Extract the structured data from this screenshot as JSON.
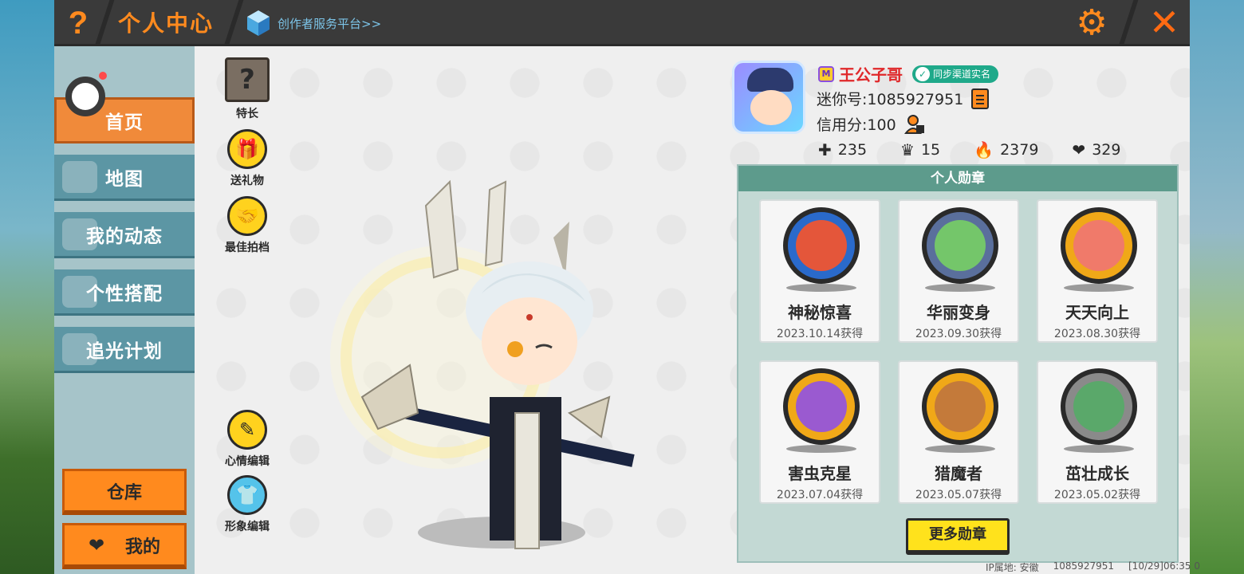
{
  "header": {
    "title": "个人中心",
    "creator_link": "创作者服务平台>>"
  },
  "nav": {
    "items": [
      {
        "label": "首页",
        "active": true
      },
      {
        "label": "地图",
        "active": false
      },
      {
        "label": "我的动态",
        "active": false
      },
      {
        "label": "个性搭配",
        "active": false
      },
      {
        "label": "追光计划",
        "active": false
      }
    ],
    "warehouse": "仓库",
    "mine": "我的"
  },
  "tools": {
    "skill": "特长",
    "gift": "送礼物",
    "partner": "最佳拍档",
    "mood": "心情编辑",
    "image": "形象编辑"
  },
  "profile": {
    "name": "王公子哥",
    "realname_badge": "同步渠道实名",
    "mini_id": "迷你号:1085927951",
    "credit": "信用分:100",
    "stats": [
      {
        "icon": "plus-icon",
        "value": "235"
      },
      {
        "icon": "fans-icon",
        "value": "15"
      },
      {
        "icon": "fire-icon",
        "value": "2379"
      },
      {
        "icon": "heart-icon",
        "value": "329"
      }
    ]
  },
  "medals": {
    "title": "个人勋章",
    "items": [
      {
        "name": "神秘惊喜",
        "date": "2023.10.14获得",
        "ring": "#2a6acb",
        "fill": "#e4563a"
      },
      {
        "name": "华丽变身",
        "date": "2023.09.30获得",
        "ring": "#5a6f9c",
        "fill": "#74c66a"
      },
      {
        "name": "天天向上",
        "date": "2023.08.30获得",
        "ring": "#f0a818",
        "fill": "#f07a6a"
      },
      {
        "name": "害虫克星",
        "date": "2023.07.04获得",
        "ring": "#f0a818",
        "fill": "#9a5ad0"
      },
      {
        "name": "猎魔者",
        "date": "2023.05.07获得",
        "ring": "#f0a818",
        "fill": "#c47a3a"
      },
      {
        "name": "茁壮成长",
        "date": "2023.05.02获得",
        "ring": "#8a8a8a",
        "fill": "#5aa86a"
      }
    ],
    "more": "更多勋章"
  },
  "footer": {
    "ip": "IP属地: 安徽",
    "uid": "1085927951",
    "time": "[10/29]06:35 0"
  },
  "colors": {
    "accent": "#ff8a1e",
    "nav": "#5c96a4",
    "medal_header": "#5d9b8c"
  }
}
